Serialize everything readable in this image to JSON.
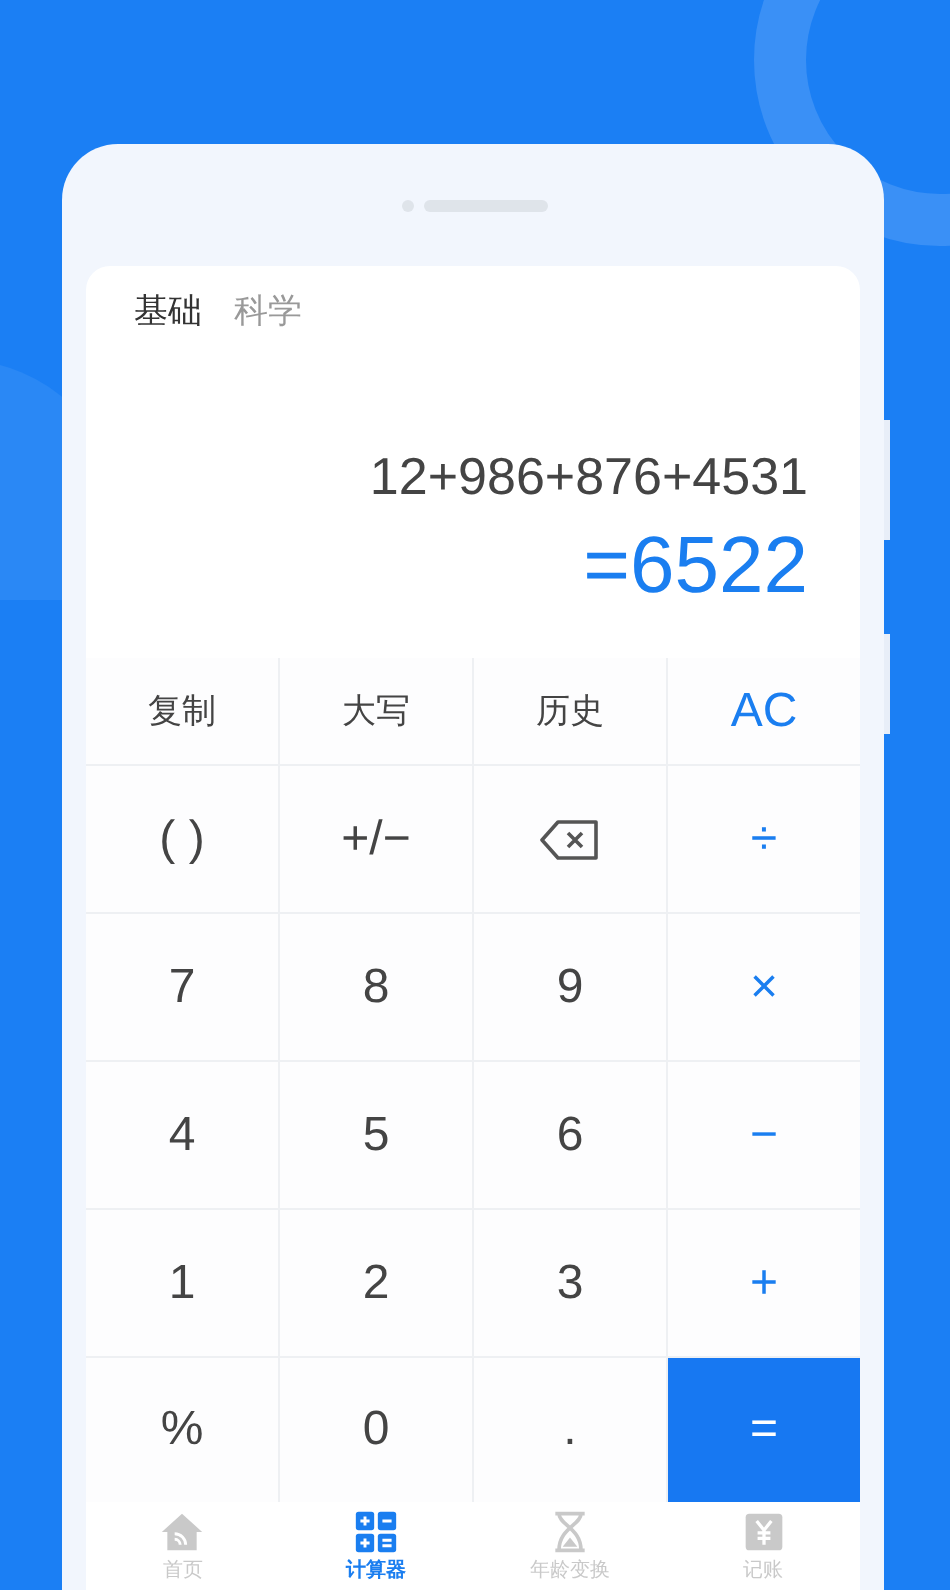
{
  "mode_tabs": [
    {
      "label": "基础",
      "selected": true
    },
    {
      "label": "科学",
      "selected": false
    }
  ],
  "display": {
    "expression": "12+986+876+4531",
    "result": "=6522"
  },
  "keys": [
    {
      "kind": "function",
      "label": "复制"
    },
    {
      "kind": "function",
      "label": "大写"
    },
    {
      "kind": "function",
      "label": "历史"
    },
    {
      "kind": "operator",
      "label": "AC"
    },
    {
      "kind": "digit",
      "label": "( )"
    },
    {
      "kind": "digit",
      "label": "+/−"
    },
    {
      "kind": "backspace"
    },
    {
      "kind": "operator",
      "label": "÷"
    },
    {
      "kind": "digit",
      "label": "7"
    },
    {
      "kind": "digit",
      "label": "8"
    },
    {
      "kind": "digit",
      "label": "9"
    },
    {
      "kind": "operator",
      "label": "×"
    },
    {
      "kind": "digit",
      "label": "4"
    },
    {
      "kind": "digit",
      "label": "5"
    },
    {
      "kind": "digit",
      "label": "6"
    },
    {
      "kind": "operator",
      "label": "−"
    },
    {
      "kind": "digit",
      "label": "1"
    },
    {
      "kind": "digit",
      "label": "2"
    },
    {
      "kind": "digit",
      "label": "3"
    },
    {
      "kind": "operator",
      "label": "+"
    },
    {
      "kind": "digit",
      "label": "%"
    },
    {
      "kind": "digit",
      "label": "0"
    },
    {
      "kind": "digit",
      "label": "."
    },
    {
      "kind": "equals",
      "label": "="
    }
  ],
  "bottom_nav": [
    {
      "kind": "home",
      "label": "首页",
      "selected": false
    },
    {
      "kind": "calculator",
      "label": "计算器",
      "selected": true
    },
    {
      "kind": "hourglass",
      "label": "年龄变换",
      "selected": false
    },
    {
      "kind": "ledger",
      "label": "记账",
      "selected": false
    }
  ]
}
